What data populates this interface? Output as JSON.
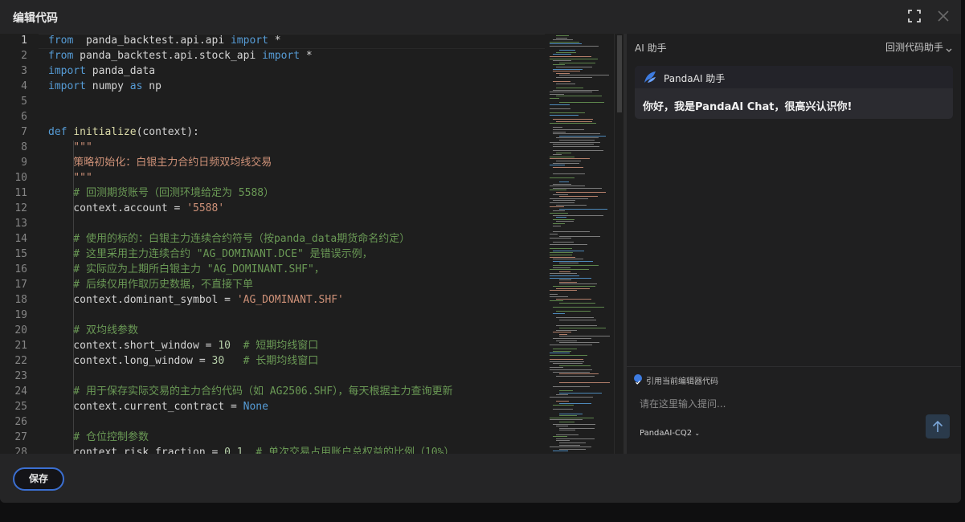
{
  "dialog": {
    "title": "编辑代码",
    "icons": [
      "fullscreen-icon",
      "close-icon"
    ]
  },
  "editor": {
    "current_line": 1,
    "lines": [
      {
        "n": "1",
        "tokens": [
          [
            "kw",
            "from"
          ],
          [
            "",
            "  panda_backtest.api.api "
          ],
          [
            "kw",
            "import"
          ],
          [
            "",
            " *"
          ]
        ]
      },
      {
        "n": "2",
        "tokens": [
          [
            "kw",
            "from"
          ],
          [
            "",
            " panda_backtest.api.stock_api "
          ],
          [
            "kw",
            "import"
          ],
          [
            "",
            " *"
          ]
        ]
      },
      {
        "n": "3",
        "tokens": [
          [
            "kw",
            "import"
          ],
          [
            "",
            " panda_data"
          ]
        ]
      },
      {
        "n": "4",
        "tokens": [
          [
            "kw",
            "import"
          ],
          [
            "",
            " numpy "
          ],
          [
            "kw",
            "as"
          ],
          [
            "",
            " np"
          ]
        ]
      },
      {
        "n": "5",
        "tokens": []
      },
      {
        "n": "6",
        "tokens": []
      },
      {
        "n": "7",
        "tokens": [
          [
            "kw",
            "def"
          ],
          [
            "",
            " "
          ],
          [
            "fn",
            "initialize"
          ],
          [
            "",
            "(context):"
          ]
        ]
      },
      {
        "n": "8",
        "tokens": [
          [
            "str",
            "    \"\"\""
          ]
        ]
      },
      {
        "n": "9",
        "tokens": [
          [
            "str",
            "    策略初始化：白银主力合约日频双均线交易"
          ]
        ]
      },
      {
        "n": "10",
        "tokens": [
          [
            "str",
            "    \"\"\""
          ]
        ]
      },
      {
        "n": "11",
        "tokens": [
          [
            "cm",
            "    # 回测期货账号（回测环境给定为 5588）"
          ]
        ]
      },
      {
        "n": "12",
        "tokens": [
          [
            "",
            "    context.account = "
          ],
          [
            "str",
            "'5588'"
          ]
        ]
      },
      {
        "n": "13",
        "tokens": []
      },
      {
        "n": "14",
        "tokens": [
          [
            "cm",
            "    # 使用的标的：白银主力连续合约符号（按panda_data期货命名约定）"
          ]
        ]
      },
      {
        "n": "15",
        "tokens": [
          [
            "cm",
            "    # 这里采用主力连续合约 \"AG_DOMINANT.DCE\" 是错误示例，"
          ]
        ]
      },
      {
        "n": "16",
        "tokens": [
          [
            "cm",
            "    # 实际应为上期所白银主力 \"AG_DOMINANT.SHF\"，"
          ]
        ]
      },
      {
        "n": "17",
        "tokens": [
          [
            "cm",
            "    # 后续仅用作取历史数据，不直接下单"
          ]
        ]
      },
      {
        "n": "18",
        "tokens": [
          [
            "",
            "    context.dominant_symbol = "
          ],
          [
            "str",
            "'AG_DOMINANT.SHF'"
          ]
        ]
      },
      {
        "n": "19",
        "tokens": []
      },
      {
        "n": "20",
        "tokens": [
          [
            "cm",
            "    # 双均线参数"
          ]
        ]
      },
      {
        "n": "21",
        "tokens": [
          [
            "",
            "    context.short_window = "
          ],
          [
            "nm",
            "10"
          ],
          [
            "",
            "  "
          ],
          [
            "cm",
            "# 短期均线窗口"
          ]
        ]
      },
      {
        "n": "22",
        "tokens": [
          [
            "",
            "    context.long_window = "
          ],
          [
            "nm",
            "30"
          ],
          [
            "",
            "   "
          ],
          [
            "cm",
            "# 长期均线窗口"
          ]
        ]
      },
      {
        "n": "23",
        "tokens": []
      },
      {
        "n": "24",
        "tokens": [
          [
            "cm",
            "    # 用于保存实际交易的主力合约代码（如 AG2506.SHF），每天根据主力查询更新"
          ]
        ]
      },
      {
        "n": "25",
        "tokens": [
          [
            "",
            "    context.current_contract = "
          ],
          [
            "kw",
            "None"
          ]
        ]
      },
      {
        "n": "26",
        "tokens": []
      },
      {
        "n": "27",
        "tokens": [
          [
            "cm",
            "    # 仓位控制参数"
          ]
        ]
      },
      {
        "n": "28",
        "tokens": [
          [
            "",
            "    context.risk_fraction = "
          ],
          [
            "nm",
            "0.1"
          ],
          [
            "",
            "  "
          ],
          [
            "cm",
            "# 单次交易占用账户总权益的比例（10%）"
          ]
        ]
      }
    ]
  },
  "ai_panel": {
    "title": "AI 助手",
    "mode": "回测代码助手",
    "assistant_name": "PandaAI 助手",
    "greeting": "你好，我是PandaAI Chat，很高兴认识你!",
    "reference_label": "引用当前编辑器代码",
    "prompt_placeholder": "请在这里输入提问...",
    "model": "PandaAI-CQ2",
    "accent": "#3d7be0"
  },
  "footer": {
    "save_label": "保存"
  }
}
